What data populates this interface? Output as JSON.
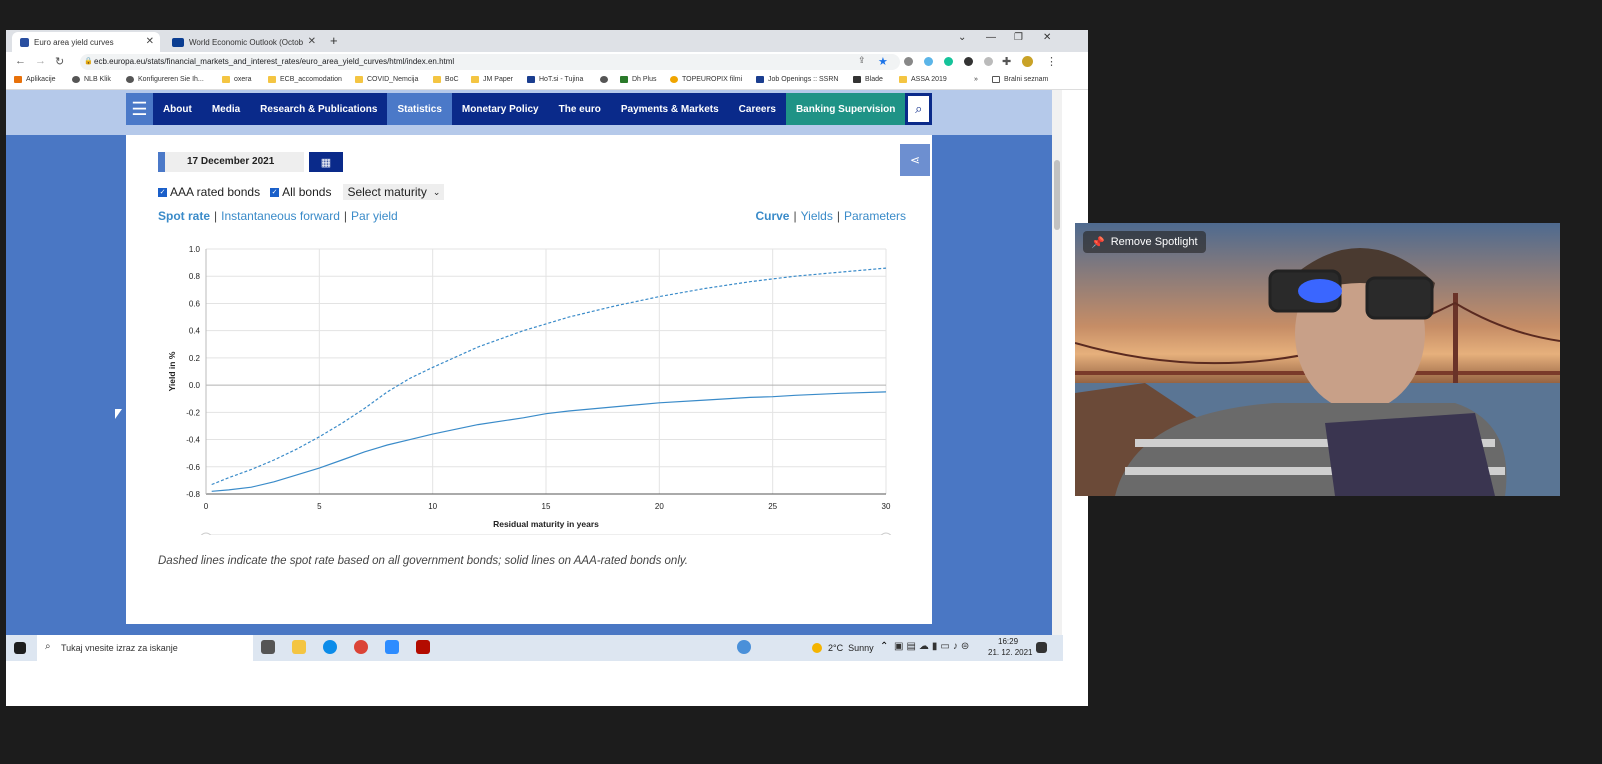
{
  "browser": {
    "tabs": [
      {
        "title": "Euro area yield curves",
        "active": true
      },
      {
        "title": "World Economic Outlook (Octob",
        "active": false
      }
    ],
    "url": "ecb.europa.eu/stats/financial_markets_and_interest_rates/euro_area_yield_curves/html/index.en.html",
    "bookmarks": [
      "Aplikacije",
      "NLB Klik",
      "Konfigureren Sie Ih...",
      "oxera",
      "ECB_accomodation",
      "COVID_Nemcija",
      "BoC",
      "JM Paper",
      "HoT.si - Tujina",
      "Dh Plus",
      "TOPEUROPIX filmi",
      "Job Openings :: SSRN",
      "Blade",
      "ASSA 2019"
    ],
    "bookmarks_more": "Bralni seznam"
  },
  "nav": {
    "items": [
      "About",
      "Media",
      "Research & Publications",
      "Statistics",
      "Monetary Policy",
      "The euro",
      "Payments & Markets",
      "Careers",
      "Banking Supervision"
    ],
    "active": "Statistics"
  },
  "controls": {
    "date": "17 December 2021",
    "aaa_label": "AAA rated bonds",
    "all_label": "All bonds",
    "maturity_select": "Select maturity",
    "left_links": [
      "Spot rate",
      "Instantaneous forward",
      "Par yield"
    ],
    "right_links": [
      "Curve",
      "Yields",
      "Parameters"
    ]
  },
  "caption": "Dashed lines indicate the spot rate based on all government bonds; solid lines on AAA-rated bonds only.",
  "chart_data": {
    "type": "line",
    "xlabel": "Residual maturity in years",
    "ylabel": "Yield in %",
    "xlim": [
      0,
      30
    ],
    "ylim": [
      -0.8,
      1.0
    ],
    "xticks": [
      0,
      5,
      10,
      15,
      20,
      25,
      30
    ],
    "yticks": [
      -0.8,
      -0.6,
      -0.4,
      -0.2,
      0.0,
      0.2,
      0.4,
      0.6,
      0.8,
      1.0
    ],
    "grid": true,
    "series": [
      {
        "style": "dashed",
        "color": "#3a8bc9",
        "x": [
          0.25,
          1,
          2,
          3,
          4,
          5,
          6,
          7,
          8,
          9,
          10,
          12,
          14,
          15,
          16,
          18,
          20,
          22,
          24,
          25,
          26,
          28,
          30
        ],
        "y": [
          -0.73,
          -0.68,
          -0.62,
          -0.55,
          -0.47,
          -0.38,
          -0.28,
          -0.17,
          -0.05,
          0.05,
          0.13,
          0.28,
          0.4,
          0.45,
          0.5,
          0.58,
          0.65,
          0.71,
          0.76,
          0.78,
          0.8,
          0.83,
          0.86
        ]
      },
      {
        "style": "solid",
        "color": "#3a8bc9",
        "x": [
          0.25,
          1,
          2,
          3,
          4,
          5,
          6,
          7,
          8,
          9,
          10,
          12,
          14,
          15,
          16,
          18,
          20,
          22,
          24,
          25,
          26,
          28,
          30
        ],
        "y": [
          -0.78,
          -0.77,
          -0.75,
          -0.71,
          -0.66,
          -0.61,
          -0.55,
          -0.49,
          -0.44,
          -0.4,
          -0.36,
          -0.29,
          -0.24,
          -0.21,
          -0.19,
          -0.16,
          -0.13,
          -0.11,
          -0.09,
          -0.085,
          -0.075,
          -0.06,
          -0.05
        ]
      }
    ]
  },
  "taskbar": {
    "search_placeholder": "Tukaj vnesite izraz za iskanje",
    "weather": "2°C  Sunny",
    "time": "16:29",
    "date": "21. 12. 2021"
  },
  "video": {
    "spotlight_label": "Remove Spotlight"
  },
  "colors": {
    "nav_bg": "#0a2a8a",
    "nav_active": "#4b79c8",
    "nav_supervision": "#1f9386",
    "page_bg": "#4a77c4",
    "link": "#3a8bc9"
  }
}
